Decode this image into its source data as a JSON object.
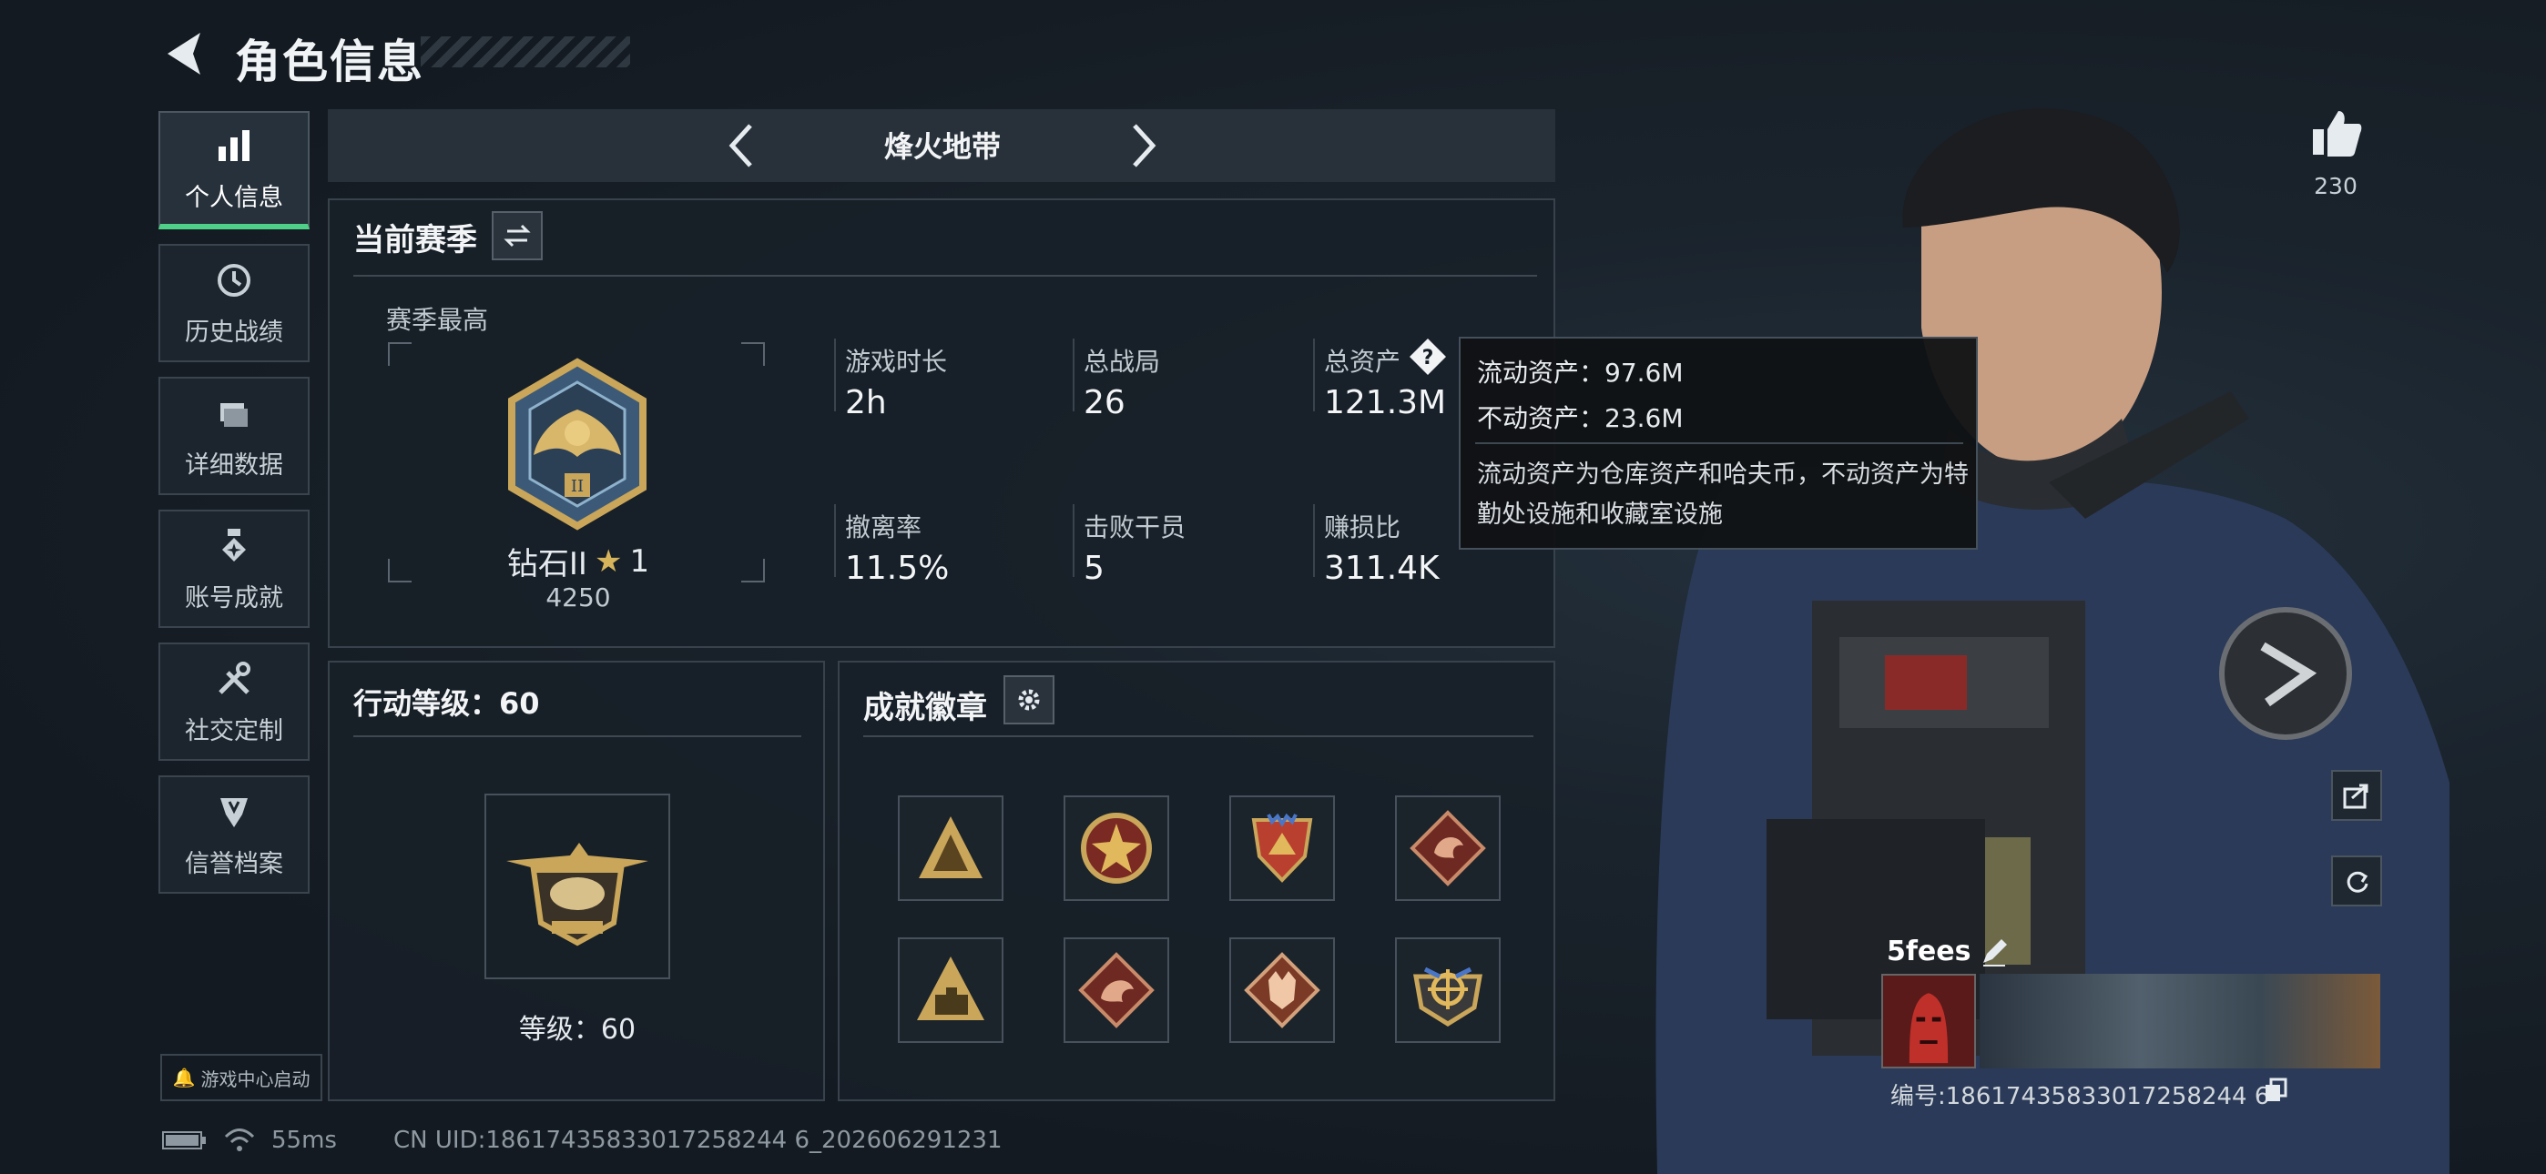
{
  "header": {
    "title": "角色信息"
  },
  "nav": [
    {
      "label": "个人信息",
      "icon": "bar-chart-icon",
      "active": true
    },
    {
      "label": "历史战绩",
      "icon": "history-icon",
      "active": false
    },
    {
      "label": "详细数据",
      "icon": "folder-icon",
      "active": false
    },
    {
      "label": "账号成就",
      "icon": "medal-icon",
      "active": false
    },
    {
      "label": "社交定制",
      "icon": "tools-icon",
      "active": false
    },
    {
      "label": "信誉档案",
      "icon": "shield-icon",
      "active": false
    }
  ],
  "launch_label": "游戏中心启动",
  "mode": {
    "name": "烽火地带"
  },
  "season": {
    "title": "当前赛季",
    "best_label": "赛季最高",
    "rank_name": "钻石II",
    "rank_stars": "1",
    "rank_points": "4250",
    "stats": [
      {
        "label": "游戏时长",
        "value": "2h"
      },
      {
        "label": "总战局",
        "value": "26"
      },
      {
        "label": "总资产",
        "value": "121.3M"
      },
      {
        "label": "撤离率",
        "value": "11.5%"
      },
      {
        "label": "击败干员",
        "value": "5"
      },
      {
        "label": "赚损比",
        "value": "311.4K"
      }
    ]
  },
  "tooltip": {
    "line1": "流动资产：97.6M",
    "line2": "不动资产：23.6M",
    "note": "流动资产为仓库资产和哈夫币，不动资产为特勤处设施和收藏室设施"
  },
  "action_level": {
    "title": "行动等级：60",
    "level_text": "等级：60"
  },
  "achievements": {
    "title": "成就徽章"
  },
  "likes": "230",
  "player": {
    "name": "5fees",
    "id_text": "编号:18617435833017258244 6"
  },
  "status": {
    "ping": "55ms",
    "uid": "CN UID:18617435833017258244 6_202606291231"
  },
  "colors": {
    "accent_green": "#4fd089",
    "panel_border": "#38424c",
    "gold": "#c9a65a"
  }
}
